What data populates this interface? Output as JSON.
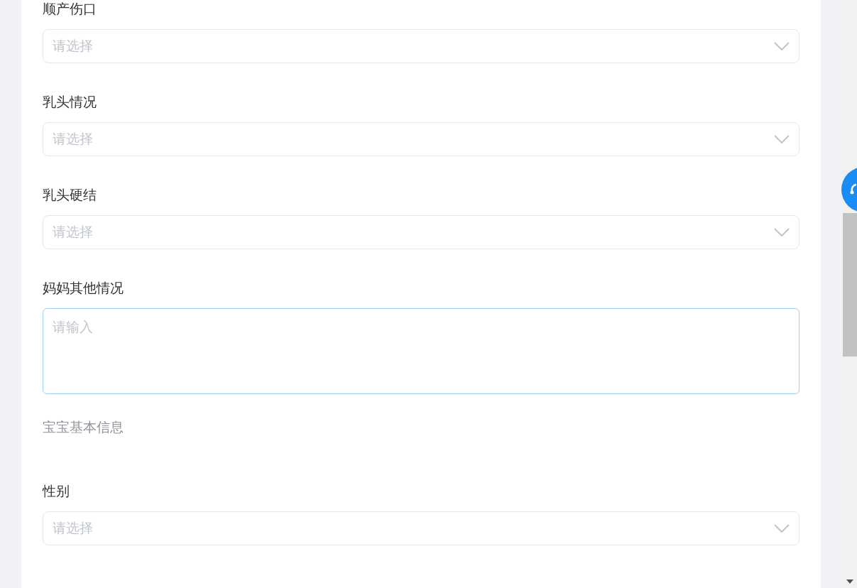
{
  "fields": [
    {
      "kind": "select",
      "label": "顺产伤口",
      "placeholder": "请选择"
    },
    {
      "kind": "select",
      "label": "乳头情况",
      "placeholder": "请选择"
    },
    {
      "kind": "select",
      "label": "乳头硬结",
      "placeholder": "请选择"
    },
    {
      "kind": "textarea",
      "label": "妈妈其他情况",
      "placeholder": "请输入"
    },
    {
      "kind": "section",
      "label": "宝宝基本信息"
    },
    {
      "kind": "select",
      "label": "性别",
      "placeholder": "请选择"
    }
  ]
}
